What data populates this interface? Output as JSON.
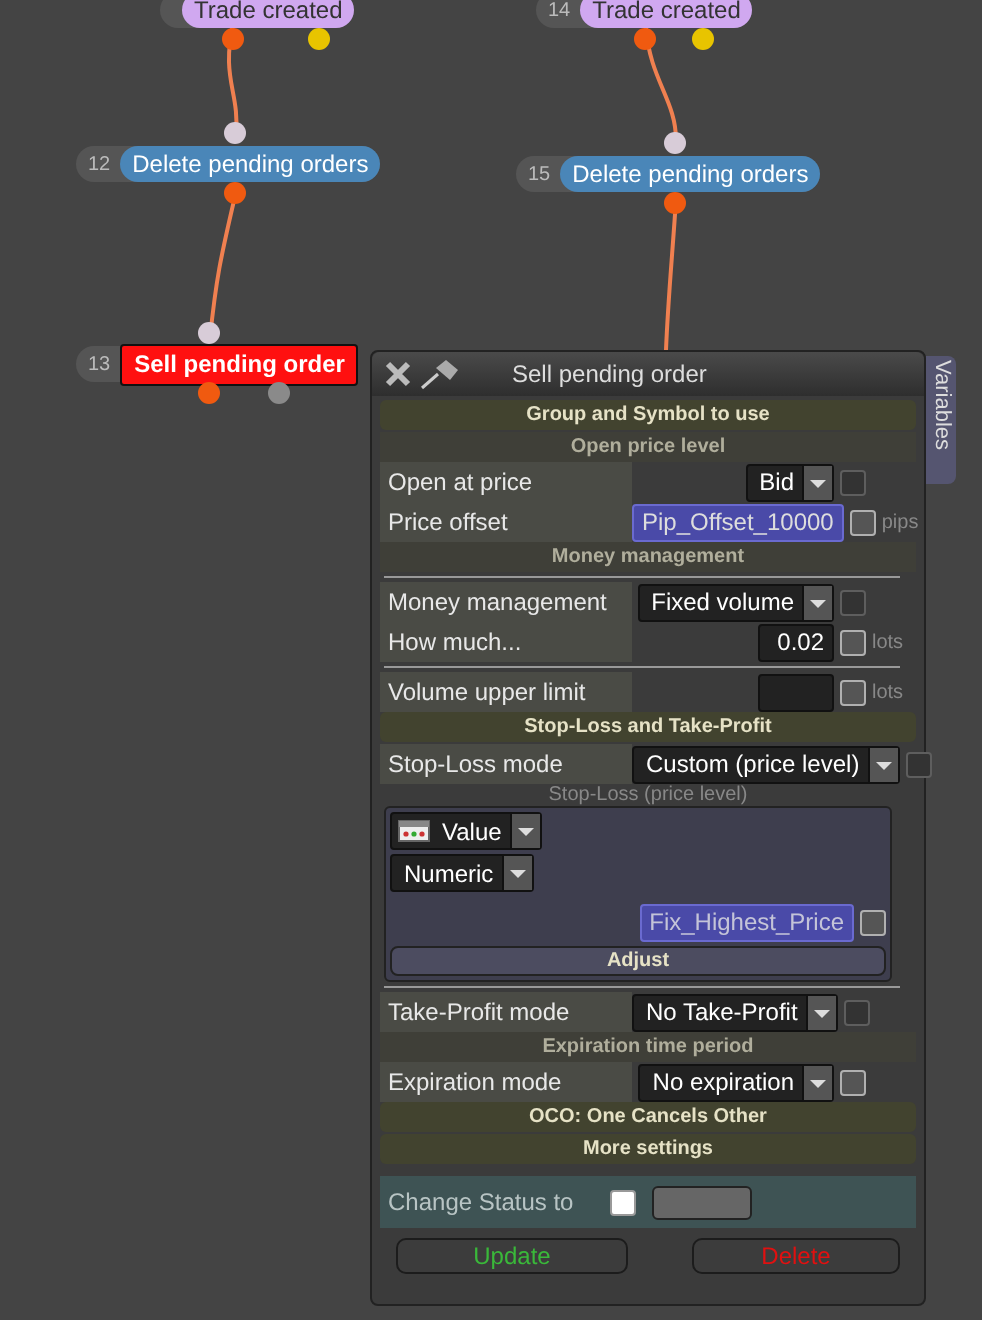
{
  "nodes": [
    {
      "label": "Trade created",
      "kind": "trigger",
      "selected": false
    },
    {
      "number": "14",
      "label": "Trade created",
      "kind": "trigger",
      "selected": false
    },
    {
      "number": "12",
      "label": "Delete pending orders",
      "kind": "action",
      "selected": false
    },
    {
      "number": "15",
      "label": "Delete pending orders",
      "kind": "action",
      "selected": false
    },
    {
      "number": "13",
      "label": "Sell pending order",
      "kind": "action",
      "selected": true
    }
  ],
  "panel": {
    "title": "Sell pending order",
    "side_tab": "Variables",
    "blocks": [
      {
        "kind": "header",
        "text": "Group and Symbol to use"
      },
      {
        "kind": "subheader",
        "text": "Open price level"
      },
      {
        "kind": "select",
        "label": "Open at price",
        "value": "Bid",
        "check_enabled": false,
        "checked": false
      },
      {
        "kind": "input",
        "label": "Price offset",
        "value": "Pip_Offset_10000",
        "variable": true,
        "unit": "pips",
        "checked": false
      },
      {
        "kind": "subheader",
        "text": "Money management"
      },
      {
        "kind": "divider"
      },
      {
        "kind": "select",
        "label": "Money management",
        "value": "Fixed volume",
        "check_enabled": false,
        "checked": false
      },
      {
        "kind": "input",
        "label": "How much...",
        "value": "0.02",
        "variable": false,
        "unit": "lots",
        "checked": false
      },
      {
        "kind": "divider"
      },
      {
        "kind": "input",
        "label": "Volume upper limit",
        "variable": false,
        "unit": "lots",
        "checked": false
      },
      {
        "kind": "header",
        "text": "Stop-Loss and Take-Profit"
      },
      {
        "kind": "select",
        "label": "Stop-Loss mode",
        "value": "Custom (price level)",
        "check_enabled": false,
        "checked": false
      },
      {
        "kind": "valuebox",
        "caption": "Stop-Loss (price level)",
        "source": "Value",
        "type": "Numeric",
        "value": "Fix_Highest_Price",
        "checked": false,
        "button": "Adjust"
      },
      {
        "kind": "divider"
      },
      {
        "kind": "select",
        "label": "Take-Profit mode",
        "value": "No Take-Profit",
        "check_enabled": false,
        "checked": false
      },
      {
        "kind": "subheader",
        "text": "Expiration time period"
      },
      {
        "kind": "select",
        "label": "Expiration mode",
        "value": "No expiration",
        "check_enabled": true,
        "checked": false
      },
      {
        "kind": "header",
        "text": "OCO: One Cancels Other"
      },
      {
        "kind": "header",
        "text": "More settings"
      }
    ],
    "status": {
      "label": "Change Status to",
      "checked": false
    },
    "buttons": [
      {
        "label": "Update",
        "kind": "update"
      },
      {
        "label": "Delete",
        "kind": "delete"
      }
    ]
  }
}
